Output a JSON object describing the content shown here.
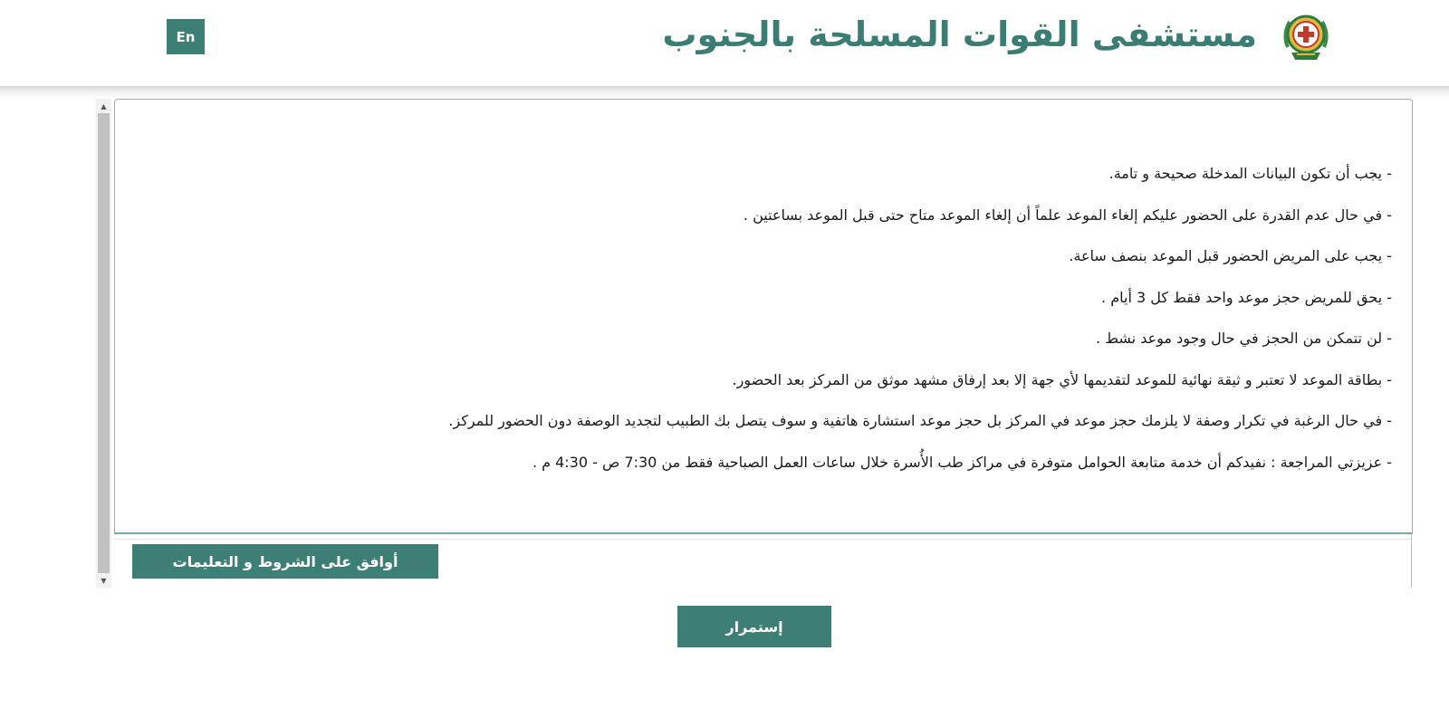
{
  "header": {
    "lang_button": "En",
    "title": "مستشفى القوات المسلحة بالجنوب",
    "logo_icon": "armed-forces-emblem-icon"
  },
  "terms": {
    "items": [
      "- يجب أن تكون البيانات المدخلة صحيحة و تامة.",
      "- في حال عدم القدرة على الحضور عليكم إلغاء الموعد علماً أن إلغاء الموعد متاح حتى قبل الموعد بساعتين .",
      "- يجب على المريض الحضور قبل الموعد بنصف ساعة.",
      "- يحق للمريض حجز موعد واحد فقط كل 3 أيام .",
      "- لن تتمكن من الحجز في حال وجود موعد نشط .",
      "- بطاقة الموعد لا تعتبر و ثيقة نهائية للموعد لتقديمها لأي جهة إلا بعد إرفاق مشهد موثق من المركز بعد الحضور.",
      "- في حال الرغبة في تكرار وصفة لا يلزمك حجز موعد في المركز بل حجز موعد استشارة هاتفية و سوف يتصل بك الطبيب لتجديد الوصفة دون الحضور للمركز.",
      "- عزيزتي المراجعة : نفيدكم أن خدمة متابعة الحوامل متوفرة في مراكز طب الأُسرة خلال ساعات العمل الصباحية فقط من 7:30 ص - 4:30 م ."
    ],
    "agree_label": "أوافق على الشروط و التعليمات"
  },
  "actions": {
    "continue_label": "إستمرار"
  },
  "colors": {
    "brand_green": "#3d7f75",
    "title_green": "#3b7d72"
  }
}
